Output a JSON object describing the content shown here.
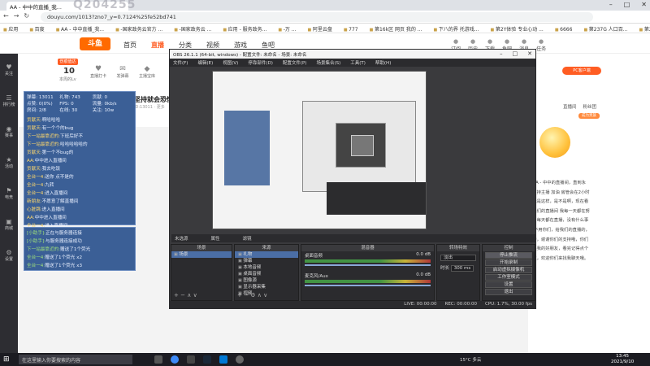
{
  "browser": {
    "tab_title": "AA - 中中的直播_我...",
    "watermark": "Q204255",
    "url": "douyu.com/1013?zno7_y=0.7124%25fe52bd741",
    "bookmarks": [
      "应用",
      "百度",
      "AA - 中中直播_我...",
      "-国家政务云官方 ...",
      "-国家政务云 ...",
      "应用 - 服务政务...",
      "-万 ...",
      "阿里云盘",
      "777",
      "第16k区 网页 我的 ...",
      "下八的界 托游戏...",
      "第2Y体验 专业心动 ...",
      "6666",
      "第237G 人口百...",
      "第237G 人口行业 ...",
      "视频教...",
      "阅读清单"
    ]
  },
  "site": {
    "logo": "斗鱼",
    "nav": [
      "首页",
      "直播",
      "分类",
      "视频",
      "游戏",
      "鱼吧"
    ],
    "active_nav": "直播",
    "header_icons": [
      "订阅",
      "历史",
      "下载",
      "鱼吧",
      "消息",
      "任务"
    ]
  },
  "sidebar": [
    "关注",
    "排行榜",
    "赛事",
    "活动",
    "电竞",
    "商城",
    "设置"
  ],
  "room": {
    "level_badge": "伤痕值达",
    "level_num": "10",
    "level_text": "本周的Lv",
    "icons": [
      "直播打卡",
      "发弹幕",
      "主播宝库"
    ],
    "title": "坚持就会恐惧!",
    "subtitle": "ID:13011",
    "extra": "更多"
  },
  "danmu": {
    "stats": [
      {
        "k": "弹幕:",
        "v": "13011"
      },
      {
        "k": "礼物:",
        "v": "743"
      },
      {
        "k": "贡献:",
        "v": "0"
      },
      {
        "k": "点赞:",
        "v": "0(0%)"
      },
      {
        "k": "FPS:",
        "v": "0"
      },
      {
        "k": "流量:",
        "v": "0kb/s"
      },
      {
        "k": "房间:",
        "v": "2/8"
      },
      {
        "k": "在线:",
        "v": "30"
      },
      {
        "k": "关注:",
        "v": "10w"
      }
    ],
    "lines": [
      {
        "n": "贡献天:",
        "t": "啊哈哈哈"
      },
      {
        "n": "贡献天:",
        "t": "有一个个的bug"
      },
      {
        "n": "下一站最靠近的:",
        "t": "下班后好不"
      },
      {
        "n": "下一站最靠近的:",
        "t": "哈哈哈哈哈的"
      },
      {
        "n": "贡献天:",
        "t": "第一个不bug的"
      },
      {
        "n": "AA:",
        "t": "中中进入直播间"
      },
      {
        "n": "贡献天:",
        "t": "我去吃饭"
      },
      {
        "n": "全台一4:",
        "t": "送你 点不是的"
      },
      {
        "n": "全台一4:",
        "t": "九转"
      },
      {
        "n": "全台一4:",
        "t": "进入直播间"
      },
      {
        "n": "新朋友:",
        "t": "不愿意了解直播间"
      },
      {
        "n": "心脏跳:",
        "t": "进入直播间"
      },
      {
        "n": "AA:",
        "t": "中中进入直播间"
      },
      {
        "n": "全台一4:",
        "t": "进入直播间"
      }
    ],
    "gift_lines": [
      {
        "n": "[小助手]:",
        "t": "正在与服务器连接"
      },
      {
        "n": "[小助手]:",
        "t": "与服务器连接成功"
      },
      {
        "n": "下一站最靠近的:",
        "t": "赠送了1个荧光"
      },
      {
        "n": "全台一4:",
        "t": "赠送了1个荧光 x2"
      },
      {
        "n": "全台一4:",
        "t": "赠送了1个荧光 x3"
      }
    ]
  },
  "right_panel": {
    "top_button": "PC客户端",
    "tabs": [
      "直播间",
      "粉丝团"
    ],
    "gift_button": "成为贵族",
    "intro": [
      "到AA - 中中的直播间，直到永",
      "远支持主播 加油 房管会在2小时",
      "，就是这样，是不是啊，现在看",
      "到我们的直播间 我每一天都在努",
      "力，每天都在直播，没有什么事",
      "情 不用你们，给我们的直播的，",
      "好的，谢谢你们的支持哦，你们",
      "都是我的好朋友，看完记得点个",
      "关注，欢迎你们来找我聊天哦。"
    ]
  },
  "obs": {
    "title": "OBS 26.1.1 (64-bit, windows) - 配置文件: 未命名 - 场景: 未命名",
    "menu": [
      "文件(F)",
      "编辑(E)",
      "视图(V)",
      "停靠部件(D)",
      "配置文件(P)",
      "场景集合(S)",
      "工具(T)",
      "帮助(H)"
    ],
    "scene_info": [
      "未选源",
      "属性",
      "滤镜"
    ],
    "docks": {
      "scenes": {
        "header": "场景",
        "items": [
          "场景"
        ]
      },
      "sources": {
        "header": "来源",
        "items": [
          "礼物",
          "弹幕",
          "本地音频",
          "桌面音频",
          "图像源",
          "显示器采集",
          "视频"
        ]
      },
      "mixer": {
        "header": "混音器",
        "items": [
          {
            "name": "桌面音频",
            "db": "0.0 dB"
          },
          {
            "name": "麦克风/Aux",
            "db": "0.0 dB"
          }
        ]
      },
      "transitions": {
        "header": "转场特效",
        "fade": "淡出",
        "duration_label": "时长",
        "duration": "300 ms"
      },
      "controls": {
        "header": "控制",
        "buttons": [
          "停止推流",
          "开始录制",
          "启动虚拟摄像机",
          "工作室模式",
          "设置",
          "退出"
        ]
      }
    },
    "status": [
      "LIVE: 00:00:00",
      "REC: 00:00:00",
      "CPU: 1.7%, 30.00 fps"
    ]
  },
  "taskbar": {
    "search_placeholder": "在这里输入你要搜索的内容",
    "tray": "15°C 多云",
    "time": "13:45",
    "date": "2021/9/10"
  }
}
